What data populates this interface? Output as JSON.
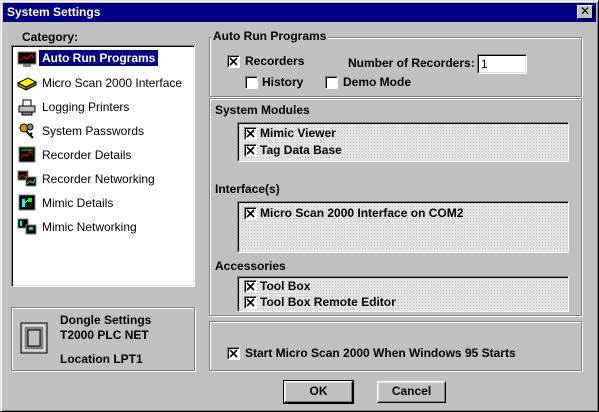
{
  "window": {
    "title": "System Settings",
    "close_glyph": "✕"
  },
  "category": {
    "label": "Category:",
    "items": [
      {
        "label": "Auto Run Programs",
        "icon": "monitor-icon",
        "selected": true
      },
      {
        "label": "Micro Scan 2000 Interface",
        "icon": "dongle-icon",
        "selected": false
      },
      {
        "label": "Logging Printers",
        "icon": "printer-icon",
        "selected": false
      },
      {
        "label": "System Passwords",
        "icon": "keys-icon",
        "selected": false
      },
      {
        "label": "Recorder Details",
        "icon": "recorder-icon",
        "selected": false
      },
      {
        "label": "Recorder Networking",
        "icon": "network-icon",
        "selected": false
      },
      {
        "label": "Mimic Details",
        "icon": "mimic-icon",
        "selected": false
      },
      {
        "label": "Mimic Networking",
        "icon": "mimic-network-icon",
        "selected": false
      }
    ]
  },
  "dongle": {
    "title": "Dongle Settings",
    "model": "T2000 PLC NET",
    "location": "Location LPT1"
  },
  "auto_run": {
    "title": "Auto Run Programs",
    "recorders_label": "Recorders",
    "recorders_checked": true,
    "num_recorders_label": "Number of Recorders:",
    "num_recorders_value": "1",
    "history_label": "History",
    "history_checked": false,
    "demo_label": "Demo Mode",
    "demo_checked": false
  },
  "system_modules": {
    "title": "System Modules",
    "items": [
      {
        "label": "Mimic Viewer",
        "checked": true
      },
      {
        "label": "Tag Data Base",
        "checked": true
      }
    ]
  },
  "interfaces": {
    "title": "Interface(s)",
    "items": [
      {
        "label": "Micro Scan 2000 Interface on COM2",
        "checked": true
      }
    ]
  },
  "accessories": {
    "title": "Accessories",
    "items": [
      {
        "label": "Tool Box",
        "checked": true
      },
      {
        "label": "Tool Box Remote Editor",
        "checked": true
      }
    ]
  },
  "startup": {
    "label": "Start Micro Scan 2000 When Windows 95 Starts",
    "checked": true
  },
  "buttons": {
    "ok": "OK",
    "cancel": "Cancel"
  },
  "colors": {
    "titlebar": "#000080",
    "face": "#c0c0c0",
    "selection": "#000080"
  }
}
